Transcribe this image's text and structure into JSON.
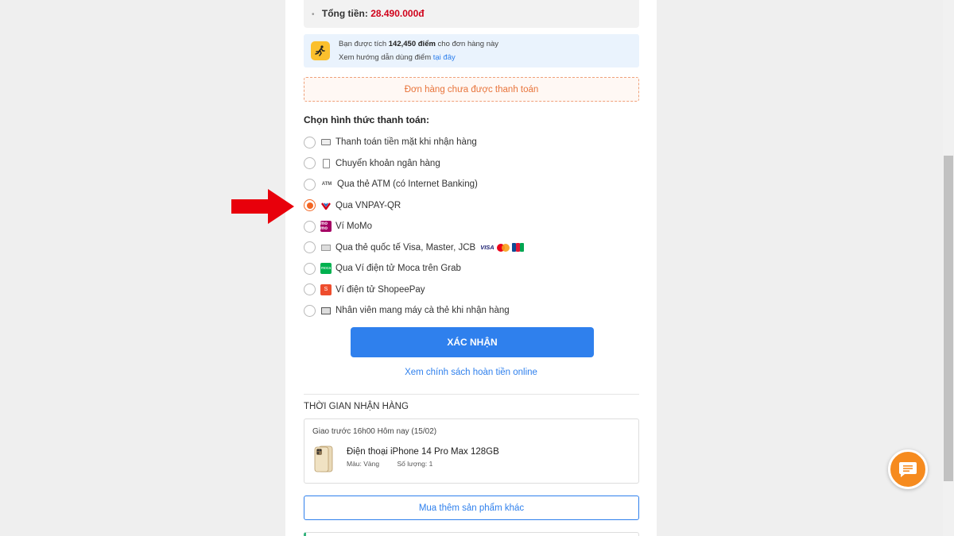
{
  "order": {
    "total_label": "Tổng tiền:",
    "total_amount": "28.490.000đ"
  },
  "points": {
    "text_before": "Bạn được tích ",
    "points_value": "142,450 điểm",
    "text_after": " cho đơn hàng này",
    "guide_text": "Xem hướng dẫn dùng điểm ",
    "guide_link": "tại đây"
  },
  "payment_status": "Đơn hàng chưa được thanh toán",
  "payment": {
    "title": "Chọn hình thức thanh toán:",
    "methods": [
      {
        "label": "Thanh toán tiền mặt khi nhận hàng",
        "icon": "cash-icon",
        "selected": false
      },
      {
        "label": "Chuyển khoản ngân hàng",
        "icon": "bank-transfer-icon",
        "selected": false
      },
      {
        "label": "Qua thẻ ATM (có Internet Banking)",
        "icon": "atm-icon",
        "icon_text": "ATM",
        "selected": false
      },
      {
        "label": "Qua VNPAY-QR",
        "icon": "vnpay-icon",
        "selected": true
      },
      {
        "label": "Ví MoMo",
        "icon": "momo-icon",
        "icon_text": "mo mo",
        "selected": false
      },
      {
        "label": "Qua thẻ quốc tế Visa, Master, JCB",
        "icon": "credit-card-icon",
        "selected": false,
        "logos_visa": "VISA"
      },
      {
        "label": "Qua Ví điện tử Moca trên Grab",
        "icon": "moca-icon",
        "icon_text": "moca",
        "selected": false
      },
      {
        "label": "Ví điện tử ShopeePay",
        "icon": "shopeepay-icon",
        "icon_text": "S",
        "selected": false
      },
      {
        "label": "Nhân viên mang máy cà thẻ khi nhận hàng",
        "icon": "pos-terminal-icon",
        "selected": false
      }
    ],
    "confirm_label": "XÁC NHẬN",
    "refund_link": "Xem chính sách hoàn tiền online"
  },
  "delivery": {
    "title": "THỜI GIAN NHẬN HÀNG",
    "time": "Giao trước 16h00 Hôm nay (15/02)",
    "product_name": "Điện thoại iPhone 14 Pro Max 128GB",
    "color": "Màu: Vàng",
    "quantity": "Số lượng: 1"
  },
  "more_products_label": "Mua thêm sản phẩm khác",
  "colors": {
    "primary_blue": "#2f80ed",
    "selected_orange": "#f26522",
    "price_red": "#d0021b",
    "chat_orange": "#f68b1f",
    "arrow_red": "#e8000b"
  }
}
